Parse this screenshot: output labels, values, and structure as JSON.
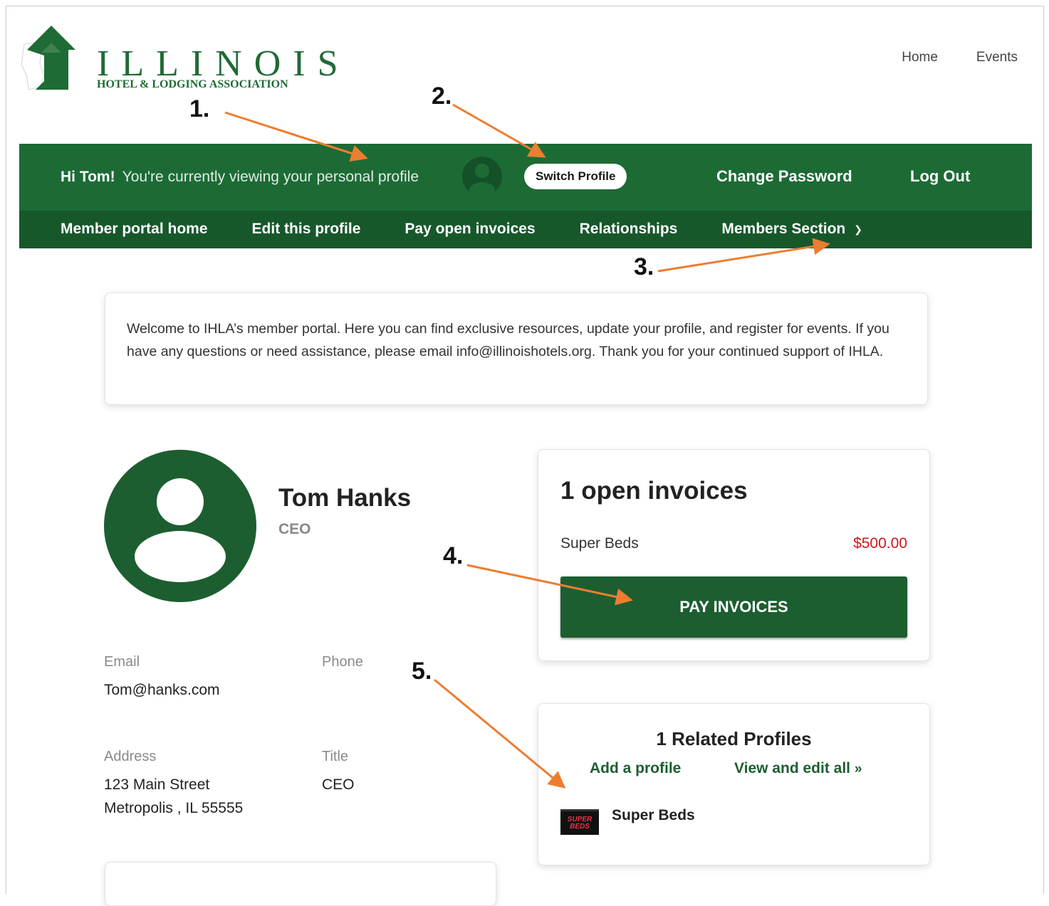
{
  "logo": {
    "word": "ILLINOIS",
    "subtitle": "HOTEL & LODGING ASSOCIATION"
  },
  "top_nav": [
    "Home",
    "Events"
  ],
  "profile_bar": {
    "greeting": "Hi Tom!",
    "message": "You're currently viewing your personal profile",
    "switch_label": "Switch Profile",
    "change_password": "Change Password",
    "log_out": "Log Out"
  },
  "portal_nav": [
    "Member portal home",
    "Edit this profile",
    "Pay open invoices",
    "Relationships",
    "Members Section"
  ],
  "annotations": [
    "1.",
    "2.",
    "3.",
    "4.",
    "5."
  ],
  "welcome_text": "Welcome to IHLA’s member portal. Here you can find exclusive resources, update your profile, and register for events. If you have any questions or need assistance, please email info@illinoishotels.org. Thank you for your continued support of IHLA.",
  "profile": {
    "name": "Tom Hanks",
    "title": "CEO",
    "email_label": "Email",
    "email": "Tom@hanks.com",
    "phone_label": "Phone",
    "address_label": "Address",
    "address_line1": "123 Main Street",
    "address_line2": "Metropolis , IL 55555",
    "title_label": "Title",
    "title_value": "CEO"
  },
  "invoices": {
    "heading": "1 open invoices",
    "item_name": "Super Beds",
    "item_amount": "$500.00",
    "pay_label": "PAY INVOICES"
  },
  "related": {
    "heading": "1 Related Profiles",
    "add_label": "Add a profile",
    "view_label": "View and edit all",
    "view_chevron": "»",
    "item_name": "Super Beds",
    "item_logo_text": "SUPER BEDS"
  },
  "colors": {
    "brand_green": "#1c6b35",
    "dark_green": "#17582b",
    "accent_orange": "#ed7d31",
    "amount_red": "#d0161b"
  }
}
